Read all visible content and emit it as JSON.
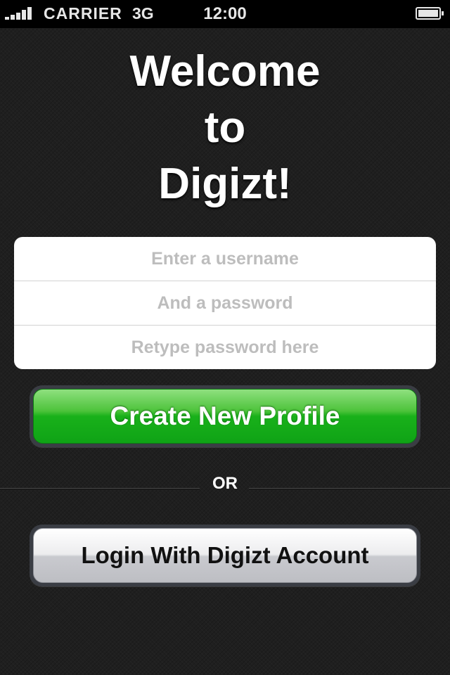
{
  "status_bar": {
    "carrier": "CARRIER",
    "network": "3G",
    "time": "12:00",
    "signal_bars": 5,
    "battery_level": 1.0
  },
  "title": {
    "line1": "Welcome",
    "line2": "to",
    "line3": "Digizt!"
  },
  "form": {
    "username_placeholder": "Enter a username",
    "password_placeholder": "And a password",
    "retype_placeholder": "Retype password here",
    "username_value": "",
    "password_value": "",
    "retype_value": ""
  },
  "buttons": {
    "create_profile_label": "Create New Profile",
    "login_label": "Login With Digizt Account"
  },
  "divider": {
    "label": "OR"
  },
  "colors": {
    "primary_button": "#19b11a",
    "secondary_button": "#d9dadd",
    "background": "#1f1f1f"
  }
}
